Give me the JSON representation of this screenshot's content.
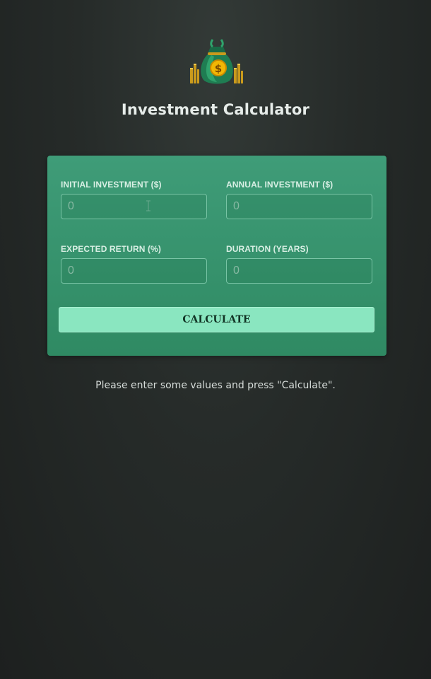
{
  "header": {
    "logo_icon": "money-bag-icon",
    "title": "Investment Calculator"
  },
  "form": {
    "fields": [
      {
        "label": "INITIAL INVESTMENT ($)",
        "placeholder": "0",
        "value": ""
      },
      {
        "label": "ANNUAL INVESTMENT ($)",
        "placeholder": "0",
        "value": ""
      },
      {
        "label": "EXPECTED RETURN (%)",
        "placeholder": "0",
        "value": ""
      },
      {
        "label": "DURATION (YEARS)",
        "placeholder": "0",
        "value": ""
      }
    ],
    "calculate_label": "CALCULATE"
  },
  "result": {
    "message": "Please enter some values and press \"Calculate\"."
  },
  "colors": {
    "card_green": "#3f9c78",
    "button_mint": "#8ae6c0",
    "background_dark": "#262b29"
  }
}
